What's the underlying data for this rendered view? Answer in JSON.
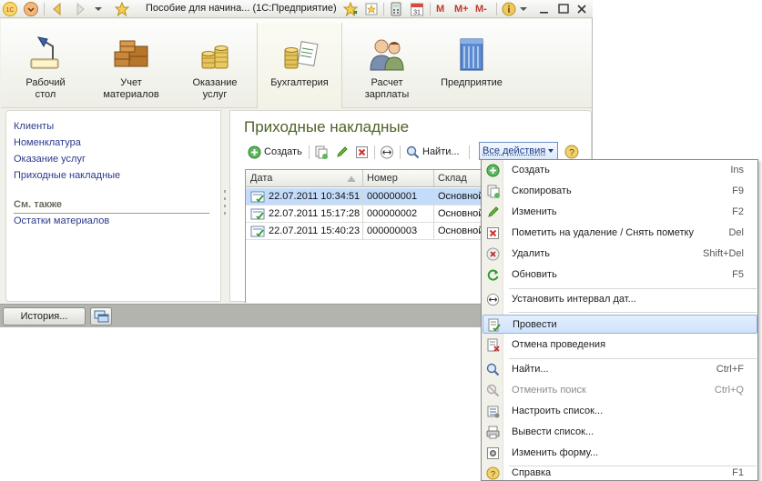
{
  "window": {
    "title": "Пособие для начина... (1С:Предприятие)",
    "toolbar_right": [
      "M",
      "M+",
      "M-"
    ],
    "help_label": "i"
  },
  "sections": [
    {
      "label": "Рабочий\nстол",
      "icon": "desk-lamp-icon"
    },
    {
      "label": "Учет\nматериалов",
      "icon": "boxes-icon"
    },
    {
      "label": "Оказание\nуслуг",
      "icon": "coins-icon"
    },
    {
      "label": "Бухгалтерия",
      "icon": "coins-document-icon",
      "active": true
    },
    {
      "label": "Расчет\nзарплаты",
      "icon": "people-icon"
    },
    {
      "label": "Предприятие",
      "icon": "building-icon"
    }
  ],
  "nav": {
    "links": [
      "Клиенты",
      "Номенклатура",
      "Оказание услуг",
      "Приходные накладные"
    ],
    "see_also_heading": "См. также",
    "see_also_links": [
      "Остатки материалов"
    ]
  },
  "content": {
    "title": "Приходные накладные",
    "create_label": "Создать",
    "find_label": "Найти...",
    "all_actions_label": "Все действия",
    "columns": [
      "Дата",
      "Номер",
      "Склад"
    ],
    "rows": [
      {
        "date": "22.07.2011 10:34:51",
        "number": "000000001",
        "warehouse": "Основной",
        "selected": true
      },
      {
        "date": "22.07.2011 15:17:28",
        "number": "000000002",
        "warehouse": "Основной",
        "selected": false
      },
      {
        "date": "22.07.2011 15:40:23",
        "number": "000000003",
        "warehouse": "Основной",
        "selected": false
      }
    ]
  },
  "statusbar": {
    "history_label": "История..."
  },
  "menu": {
    "groups": [
      [
        {
          "label": "Создать",
          "key": "Ins",
          "icon": "plus-green-icon"
        },
        {
          "label": "Скопировать",
          "key": "F9",
          "icon": "copy-icon"
        },
        {
          "label": "Изменить",
          "key": "F2",
          "icon": "pencil-icon"
        },
        {
          "label": "Пометить на удаление / Снять пометку",
          "key": "Del",
          "icon": "mark-delete-icon"
        },
        {
          "label": "Удалить",
          "key": "Shift+Del",
          "icon": "delete-icon"
        },
        {
          "label": "Обновить",
          "key": "F5",
          "icon": "refresh-icon"
        }
      ],
      [
        {
          "label": "Установить интервал дат...",
          "key": "",
          "icon": "date-interval-icon"
        }
      ],
      [
        {
          "label": "Провести",
          "key": "",
          "icon": "post-document-icon",
          "highlighted": true
        },
        {
          "label": "Отмена проведения",
          "key": "",
          "icon": "unpost-document-icon"
        }
      ],
      [
        {
          "label": "Найти...",
          "key": "Ctrl+F",
          "icon": "find-icon"
        },
        {
          "label": "Отменить поиск",
          "key": "Ctrl+Q",
          "icon": "cancel-search-icon",
          "disabled": true
        },
        {
          "label": "Настроить список...",
          "key": "",
          "icon": "configure-list-icon"
        },
        {
          "label": "Вывести список...",
          "key": "",
          "icon": "print-list-icon"
        },
        {
          "label": "Изменить форму...",
          "key": "",
          "icon": "change-form-icon"
        }
      ],
      [
        {
          "label": "Справка",
          "key": "F1",
          "icon": "help-icon"
        }
      ]
    ]
  }
}
